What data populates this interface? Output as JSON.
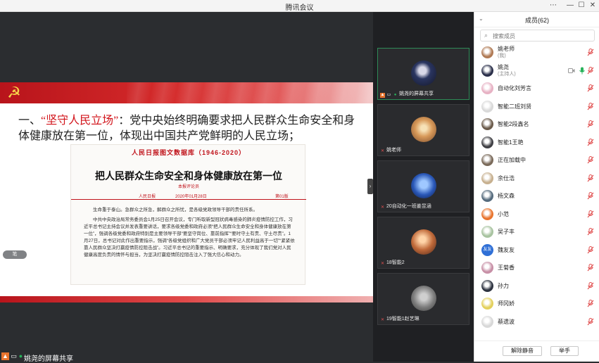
{
  "app": {
    "title": "腾讯会议"
  },
  "window_controls": {
    "menu": "⋯",
    "minimize": "—",
    "maximize": "☐",
    "close": "✕"
  },
  "share": {
    "heading_prefix": "一、",
    "heading_highlight": "“坚守人民立场”",
    "heading_rest": "：党中央始终明确要求把人民群众生命安全和身体健康放在第一位，体现出中国共产党鲜明的人民立场；",
    "article": {
      "band": "人民日报图文数据库（1946-2020）",
      "title": "把人民群众生命安全和身体健康放在第一位",
      "byline": "本报评论员",
      "meta_source": "人民日报",
      "meta_date": "2020年01月28日",
      "meta_page": "第01版",
      "paragraphs": [
        "生命重于泰山。急群众之所急，解群众之所忧，是各级党政领导干部的责任所系。",
        "中共中央政治局常务委员会1月25日召开会议，专门听取新型冠状病毒感染的肺炎疫情防控工作，习近平总书记主持会议并发表重要讲话，要求各级党委和政府必须“把人民群众生命安全和身体健康放在第一位”，强调各级党委和政府特别是主要领导干部“要坚守岗位、靠前指挥”“要时守土有责、守土尽责”。1月27日，总书记对此作出重要指示，强调“各级党组织和广大党员干部必须牢记人民利益高于一切”“紧紧依靠人民群众坚决打赢疫情防控阻击战”。习近平总书记的重要指示、明确要求，充分体现了我们党对人民健康高度负责的情怀与担当，为坚决打赢疫情防控阻击注入了强大信心和动力。"
      ]
    },
    "chip_label": "笔",
    "sharer_label": "姚尧的屏幕共享"
  },
  "video_tiles": [
    {
      "name": "姚尧的屏幕共享",
      "active": true
    },
    {
      "name": "姚老师",
      "active": false
    },
    {
      "name": "20自动化一班姜昱涵",
      "active": false
    },
    {
      "name": "18智能2",
      "active": false
    },
    {
      "name": "19智能1赵艺琳",
      "active": false
    }
  ],
  "members_panel": {
    "title": "成员(62)",
    "search_placeholder": "搜索成员",
    "members": [
      {
        "name": "姚老师",
        "sub": "(我)",
        "avatar_color": "#b07a54",
        "mic": "off"
      },
      {
        "name": "姚尧",
        "sub": "(主持人)",
        "avatar_color": "#2a2f4a",
        "mic": "on"
      },
      {
        "name": "自动化刘芳言",
        "sub": "",
        "avatar_color": "#e7b2c4",
        "mic": "off"
      },
      {
        "name": "智能二班刘贤",
        "sub": "",
        "avatar_color": "#d9d9d9",
        "mic": "off"
      },
      {
        "name": "智能2段鑫名",
        "sub": "",
        "avatar_color": "#6b5b4b",
        "mic": "off"
      },
      {
        "name": "智能1王艳",
        "sub": "",
        "avatar_color": "#3f3f44",
        "mic": "off"
      },
      {
        "name": "正在加载中",
        "sub": "",
        "avatar_color": "#7a6a5a",
        "mic": "off"
      },
      {
        "name": "余仕浩",
        "sub": "",
        "avatar_color": "#c7b08f",
        "mic": "off"
      },
      {
        "name": "杨文森",
        "sub": "",
        "avatar_color": "#556b7d",
        "mic": "off"
      },
      {
        "name": "小范",
        "sub": "",
        "avatar_color": "#e8742e",
        "mic": "off"
      },
      {
        "name": "吴子丰",
        "sub": "",
        "avatar_color": "#a8c3a0",
        "mic": "off"
      },
      {
        "name": "魏友友",
        "sub": "",
        "avatar_color": "#2f6fd6",
        "avatar_text": "友友",
        "mic": "off"
      },
      {
        "name": "王菊香",
        "sub": "",
        "avatar_color": "#c78fa6",
        "mic": "off"
      },
      {
        "name": "孙力",
        "sub": "",
        "avatar_color": "#2d3340",
        "mic": "off"
      },
      {
        "name": "师冈娇",
        "sub": "",
        "avatar_color": "#e3d05c",
        "mic": "off"
      },
      {
        "name": "蔡遗波",
        "sub": "",
        "avatar_color": "#d8d8d8",
        "mic": "off"
      },
      {
        "name": "…",
        "sub": "",
        "avatar_color": "#e7c9a7",
        "mic": "off"
      }
    ],
    "unmute_all_label": "解除静音",
    "raise_hand_label": "举手"
  },
  "colors": {
    "mic_off": "#e05050",
    "mic_on": "#28b35b",
    "accent_red": "#d2141b"
  }
}
